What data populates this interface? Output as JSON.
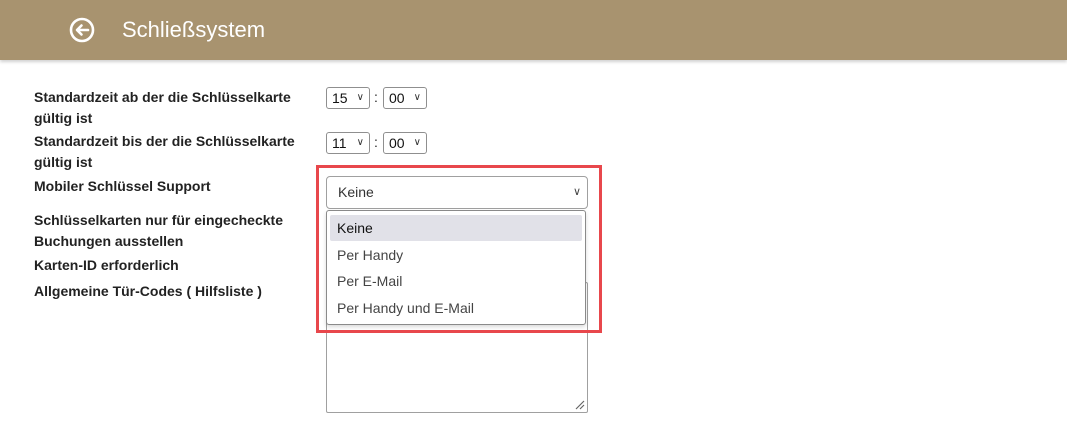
{
  "header": {
    "title": "Schließsystem",
    "background_color": "#a8936f",
    "back_icon": "circle-arrow-left-icon"
  },
  "fields": {
    "start_time": {
      "label": "Standardzeit ab der die Schlüsselkarte gültig ist",
      "hour": "15",
      "minute": "00",
      "separator": ":"
    },
    "end_time": {
      "label": "Standardzeit bis der die Schlüsselkarte gültig ist",
      "hour": "11",
      "minute": "00",
      "separator": ":"
    },
    "mobile_key": {
      "label": "Mobiler Schlüssel Support",
      "selected": "Keine",
      "options": [
        "Keine",
        "Per Handy",
        "Per E-Mail",
        "Per Handy und E-Mail"
      ]
    },
    "checked_in_only": {
      "label": "Schlüsselkarten nur für eingecheckte Buchungen ausstellen"
    },
    "card_id_required": {
      "label": "Karten-ID erforderlich"
    },
    "door_codes": {
      "label": "Allgemeine Tür-Codes ( Hilfsliste )"
    }
  },
  "highlight_color": "#e8474c"
}
